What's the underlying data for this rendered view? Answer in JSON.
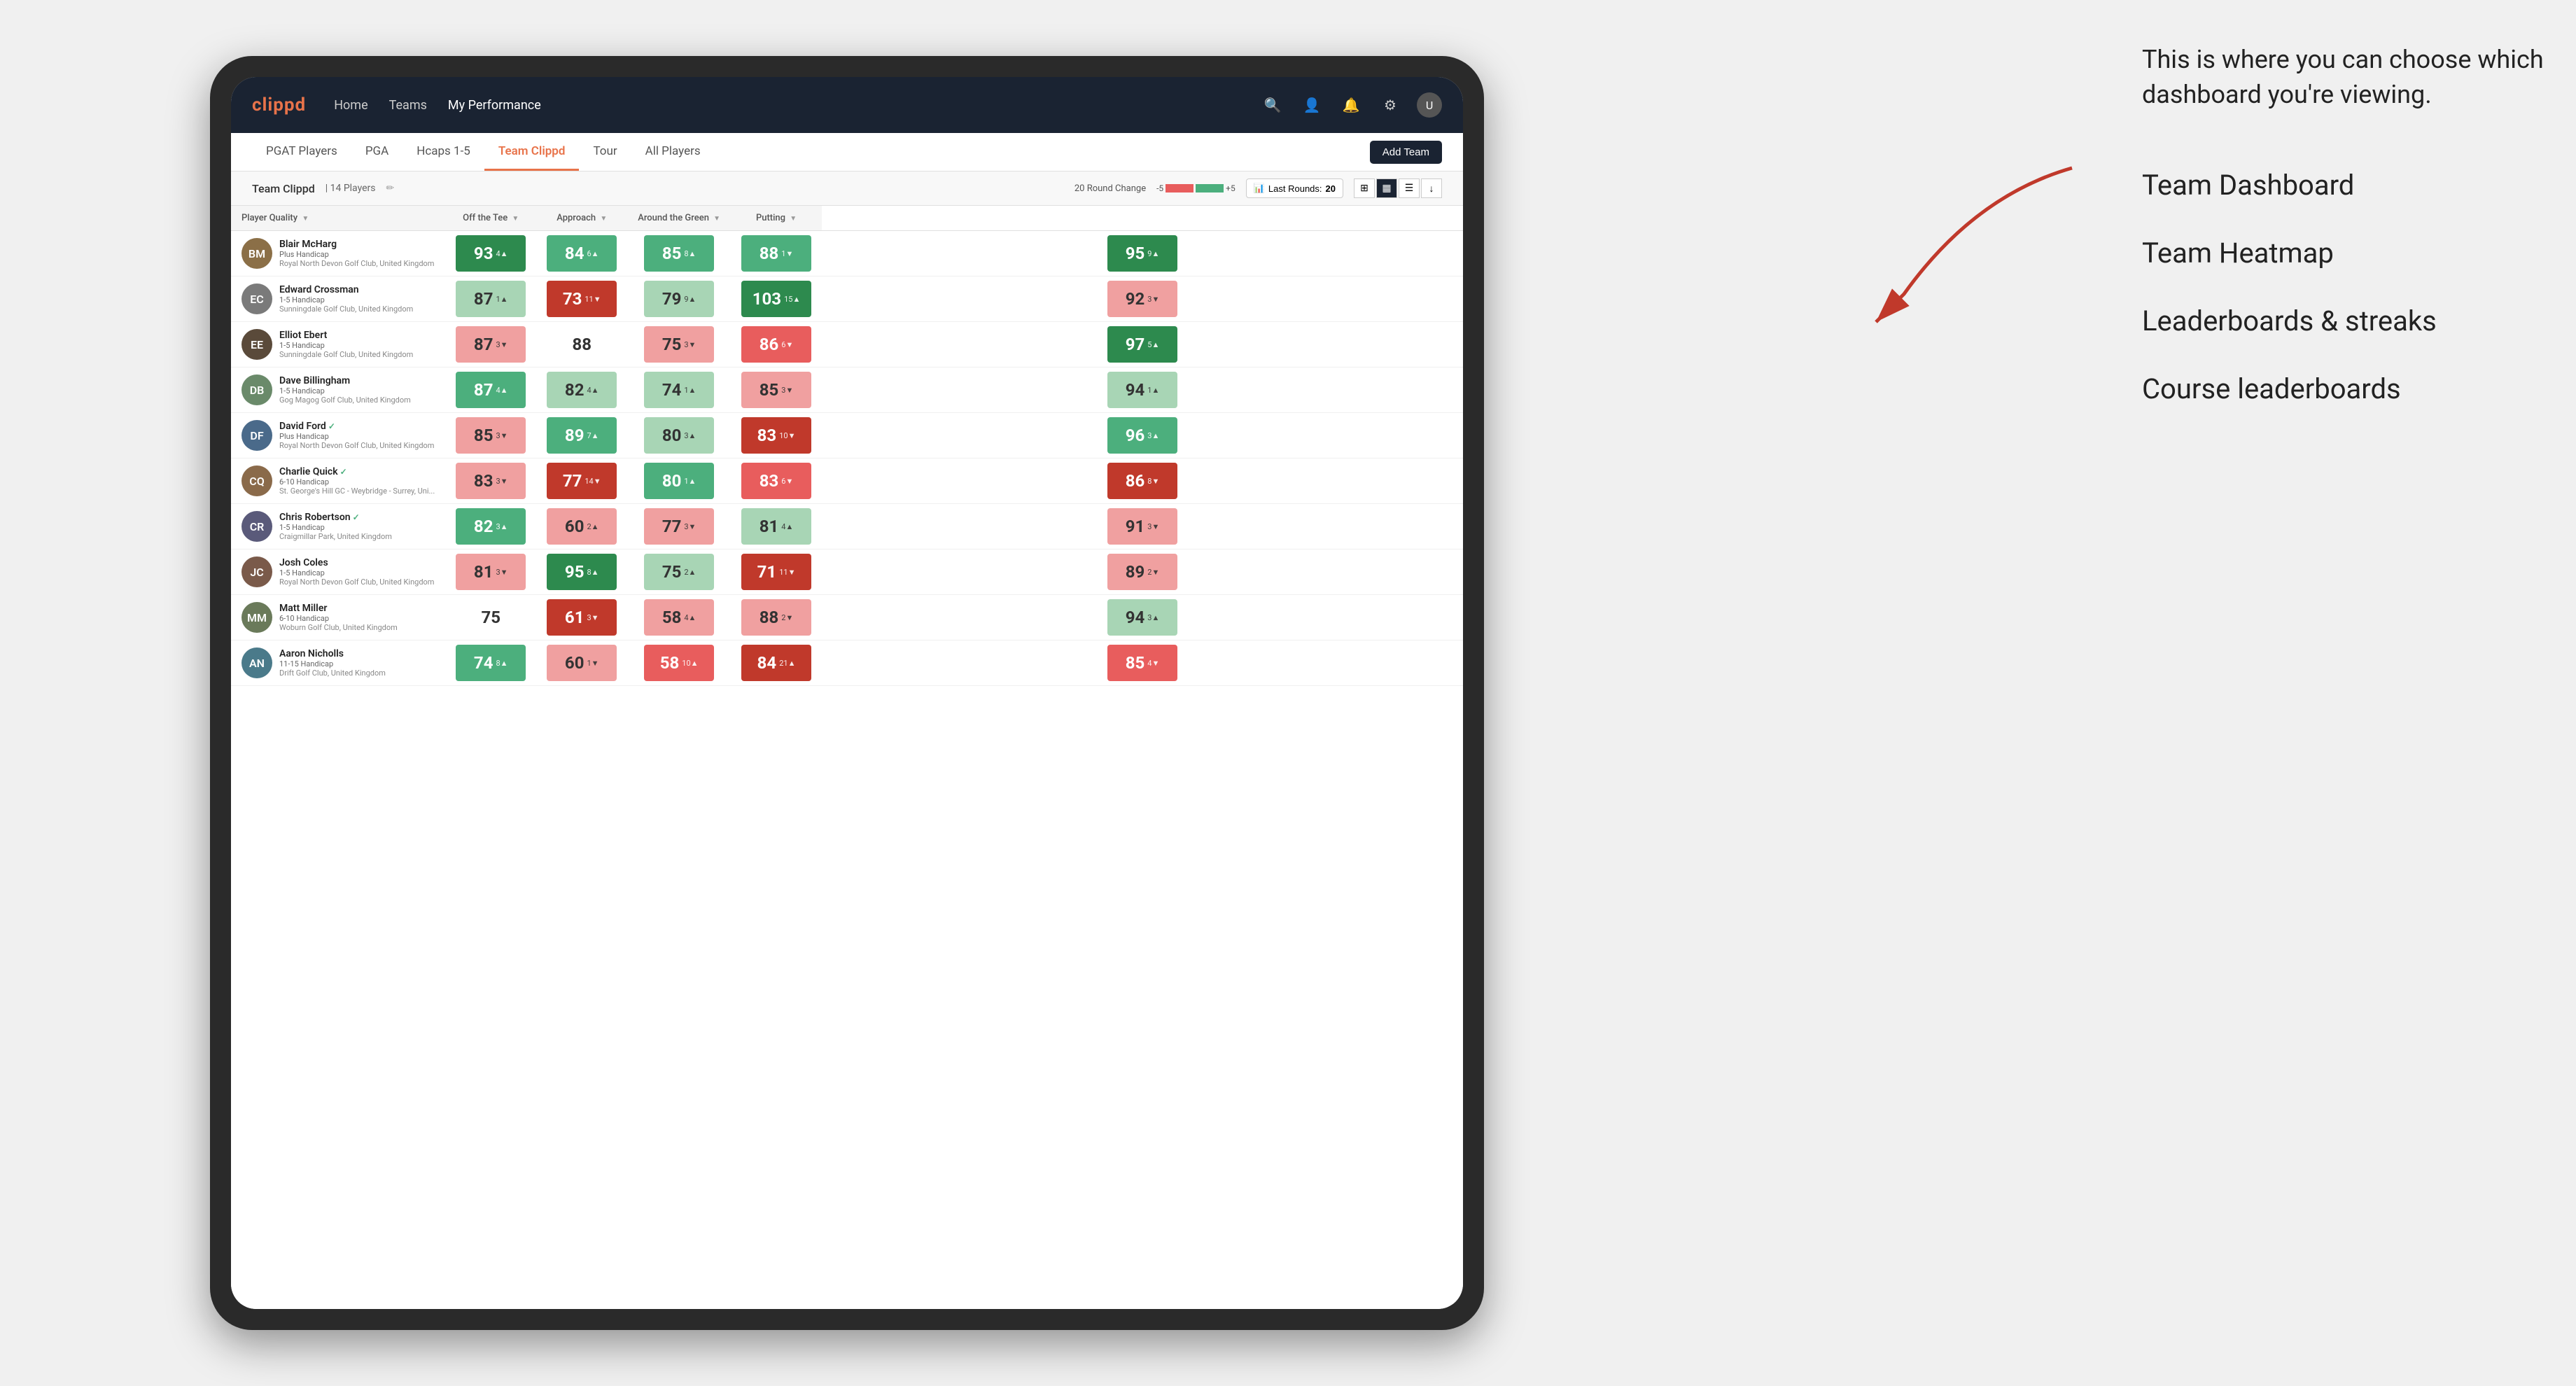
{
  "annotation": {
    "intro_text": "This is where you can choose which dashboard you're viewing.",
    "items": [
      "Team Dashboard",
      "Team Heatmap",
      "Leaderboards & streaks",
      "Course leaderboards"
    ]
  },
  "navbar": {
    "logo": "clippd",
    "links": [
      "Home",
      "Teams",
      "My Performance"
    ],
    "active_link": "My Performance"
  },
  "subnav": {
    "links": [
      "PGAT Players",
      "PGA",
      "Hcaps 1-5",
      "Team Clippd",
      "Tour",
      "All Players"
    ],
    "active_link": "Team Clippd",
    "add_team_label": "Add Team"
  },
  "team_header": {
    "name": "Team Clippd",
    "separator": "|",
    "count": "14 Players",
    "round_change_label": "20 Round Change",
    "bar_neg": "-5",
    "bar_pos": "+5",
    "last_rounds_label": "Last Rounds:",
    "last_rounds_value": "20"
  },
  "table": {
    "columns": [
      {
        "id": "player",
        "label": "Player Quality ▼",
        "sortable": true
      },
      {
        "id": "off_tee",
        "label": "Off the Tee ▼",
        "sortable": true
      },
      {
        "id": "approach",
        "label": "Approach ▼",
        "sortable": true
      },
      {
        "id": "around_green",
        "label": "Around the Green ▼",
        "sortable": true
      },
      {
        "id": "putting",
        "label": "Putting ▼",
        "sortable": true
      }
    ],
    "rows": [
      {
        "name": "Blair McHarg",
        "hcp": "Plus Handicap",
        "club": "Royal North Devon Golf Club, United Kingdom",
        "verified": false,
        "avatar_color": "#8B6F47",
        "initials": "BM",
        "player_quality": {
          "value": 93,
          "change": 4,
          "dir": "up",
          "color": "green-dark"
        },
        "off_tee": {
          "value": 84,
          "change": 6,
          "dir": "up",
          "color": "green-mid"
        },
        "approach": {
          "value": 85,
          "change": 8,
          "dir": "up",
          "color": "green-mid"
        },
        "around_green": {
          "value": 88,
          "change": 1,
          "dir": "down",
          "color": "green-mid"
        },
        "putting": {
          "value": 95,
          "change": 9,
          "dir": "up",
          "color": "green-dark"
        }
      },
      {
        "name": "Edward Crossman",
        "hcp": "1-5 Handicap",
        "club": "Sunningdale Golf Club, United Kingdom",
        "verified": false,
        "avatar_color": "#7a7a7a",
        "initials": "EC",
        "player_quality": {
          "value": 87,
          "change": 1,
          "dir": "up",
          "color": "green-light"
        },
        "off_tee": {
          "value": 73,
          "change": 11,
          "dir": "down",
          "color": "red-dark"
        },
        "approach": {
          "value": 79,
          "change": 9,
          "dir": "up",
          "color": "green-light"
        },
        "around_green": {
          "value": 103,
          "change": 15,
          "dir": "up",
          "color": "green-dark"
        },
        "putting": {
          "value": 92,
          "change": 3,
          "dir": "down",
          "color": "red-light"
        }
      },
      {
        "name": "Elliot Ebert",
        "hcp": "1-5 Handicap",
        "club": "Sunningdale Golf Club, United Kingdom",
        "verified": false,
        "avatar_color": "#5a4a3a",
        "initials": "EE",
        "player_quality": {
          "value": 87,
          "change": 3,
          "dir": "down",
          "color": "red-light"
        },
        "off_tee": {
          "value": 88,
          "change": null,
          "dir": null,
          "color": "white-bg"
        },
        "approach": {
          "value": 75,
          "change": 3,
          "dir": "down",
          "color": "red-light"
        },
        "around_green": {
          "value": 86,
          "change": 6,
          "dir": "down",
          "color": "red-mid"
        },
        "putting": {
          "value": 97,
          "change": 5,
          "dir": "up",
          "color": "green-dark"
        }
      },
      {
        "name": "Dave Billingham",
        "hcp": "1-5 Handicap",
        "club": "Gog Magog Golf Club, United Kingdom",
        "verified": false,
        "avatar_color": "#6a8a6a",
        "initials": "DB",
        "player_quality": {
          "value": 87,
          "change": 4,
          "dir": "up",
          "color": "green-mid"
        },
        "off_tee": {
          "value": 82,
          "change": 4,
          "dir": "up",
          "color": "green-light"
        },
        "approach": {
          "value": 74,
          "change": 1,
          "dir": "up",
          "color": "green-light"
        },
        "around_green": {
          "value": 85,
          "change": 3,
          "dir": "down",
          "color": "red-light"
        },
        "putting": {
          "value": 94,
          "change": 1,
          "dir": "up",
          "color": "green-light"
        }
      },
      {
        "name": "David Ford",
        "hcp": "Plus Handicap",
        "club": "Royal North Devon Golf Club, United Kingdom",
        "verified": true,
        "avatar_color": "#4a6a8a",
        "initials": "DF",
        "player_quality": {
          "value": 85,
          "change": 3,
          "dir": "down",
          "color": "red-light"
        },
        "off_tee": {
          "value": 89,
          "change": 7,
          "dir": "up",
          "color": "green-mid"
        },
        "approach": {
          "value": 80,
          "change": 3,
          "dir": "up",
          "color": "green-light"
        },
        "around_green": {
          "value": 83,
          "change": 10,
          "dir": "down",
          "color": "red-dark"
        },
        "putting": {
          "value": 96,
          "change": 3,
          "dir": "up",
          "color": "green-mid"
        }
      },
      {
        "name": "Charlie Quick",
        "hcp": "6-10 Handicap",
        "club": "St. George's Hill GC - Weybridge - Surrey, Uni...",
        "verified": true,
        "avatar_color": "#8a6a4a",
        "initials": "CQ",
        "player_quality": {
          "value": 83,
          "change": 3,
          "dir": "down",
          "color": "red-light"
        },
        "off_tee": {
          "value": 77,
          "change": 14,
          "dir": "down",
          "color": "red-dark"
        },
        "approach": {
          "value": 80,
          "change": 1,
          "dir": "up",
          "color": "green-mid"
        },
        "around_green": {
          "value": 83,
          "change": 6,
          "dir": "down",
          "color": "red-mid"
        },
        "putting": {
          "value": 86,
          "change": 8,
          "dir": "down",
          "color": "red-dark"
        }
      },
      {
        "name": "Chris Robertson",
        "hcp": "1-5 Handicap",
        "club": "Craigmillar Park, United Kingdom",
        "verified": true,
        "avatar_color": "#5a5a7a",
        "initials": "CR",
        "player_quality": {
          "value": 82,
          "change": 3,
          "dir": "up",
          "color": "green-mid"
        },
        "off_tee": {
          "value": 60,
          "change": 2,
          "dir": "up",
          "color": "red-light"
        },
        "approach": {
          "value": 77,
          "change": 3,
          "dir": "down",
          "color": "red-light"
        },
        "around_green": {
          "value": 81,
          "change": 4,
          "dir": "up",
          "color": "green-light"
        },
        "putting": {
          "value": 91,
          "change": 3,
          "dir": "down",
          "color": "red-light"
        }
      },
      {
        "name": "Josh Coles",
        "hcp": "1-5 Handicap",
        "club": "Royal North Devon Golf Club, United Kingdom",
        "verified": false,
        "avatar_color": "#7a5a4a",
        "initials": "JC",
        "player_quality": {
          "value": 81,
          "change": 3,
          "dir": "down",
          "color": "red-light"
        },
        "off_tee": {
          "value": 95,
          "change": 8,
          "dir": "up",
          "color": "green-dark"
        },
        "approach": {
          "value": 75,
          "change": 2,
          "dir": "up",
          "color": "green-light"
        },
        "around_green": {
          "value": 71,
          "change": 11,
          "dir": "down",
          "color": "red-dark"
        },
        "putting": {
          "value": 89,
          "change": 2,
          "dir": "down",
          "color": "red-light"
        }
      },
      {
        "name": "Matt Miller",
        "hcp": "6-10 Handicap",
        "club": "Woburn Golf Club, United Kingdom",
        "verified": false,
        "avatar_color": "#6a7a5a",
        "initials": "MM",
        "player_quality": {
          "value": 75,
          "change": null,
          "dir": null,
          "color": "white-bg"
        },
        "off_tee": {
          "value": 61,
          "change": 3,
          "dir": "down",
          "color": "red-dark"
        },
        "approach": {
          "value": 58,
          "change": 4,
          "dir": "up",
          "color": "red-light"
        },
        "around_green": {
          "value": 88,
          "change": 2,
          "dir": "down",
          "color": "red-light"
        },
        "putting": {
          "value": 94,
          "change": 3,
          "dir": "up",
          "color": "green-light"
        }
      },
      {
        "name": "Aaron Nicholls",
        "hcp": "11-15 Handicap",
        "club": "Drift Golf Club, United Kingdom",
        "verified": false,
        "avatar_color": "#4a7a8a",
        "initials": "AN",
        "player_quality": {
          "value": 74,
          "change": 8,
          "dir": "up",
          "color": "green-mid"
        },
        "off_tee": {
          "value": 60,
          "change": 1,
          "dir": "down",
          "color": "red-light"
        },
        "approach": {
          "value": 58,
          "change": 10,
          "dir": "up",
          "color": "red-mid"
        },
        "around_green": {
          "value": 84,
          "change": 21,
          "dir": "up",
          "color": "red-dark"
        },
        "putting": {
          "value": 85,
          "change": 4,
          "dir": "down",
          "color": "red-mid"
        }
      }
    ]
  },
  "colors": {
    "green_dark": "#2d8a4e",
    "green_mid": "#4caf7d",
    "green_light": "#a8d5b5",
    "red_dark": "#c0392b",
    "red_mid": "#e85d5d",
    "red_light": "#f0a0a0",
    "white_bg": "#ffffff",
    "nav_bg": "#1a2332",
    "accent": "#e8734a"
  }
}
